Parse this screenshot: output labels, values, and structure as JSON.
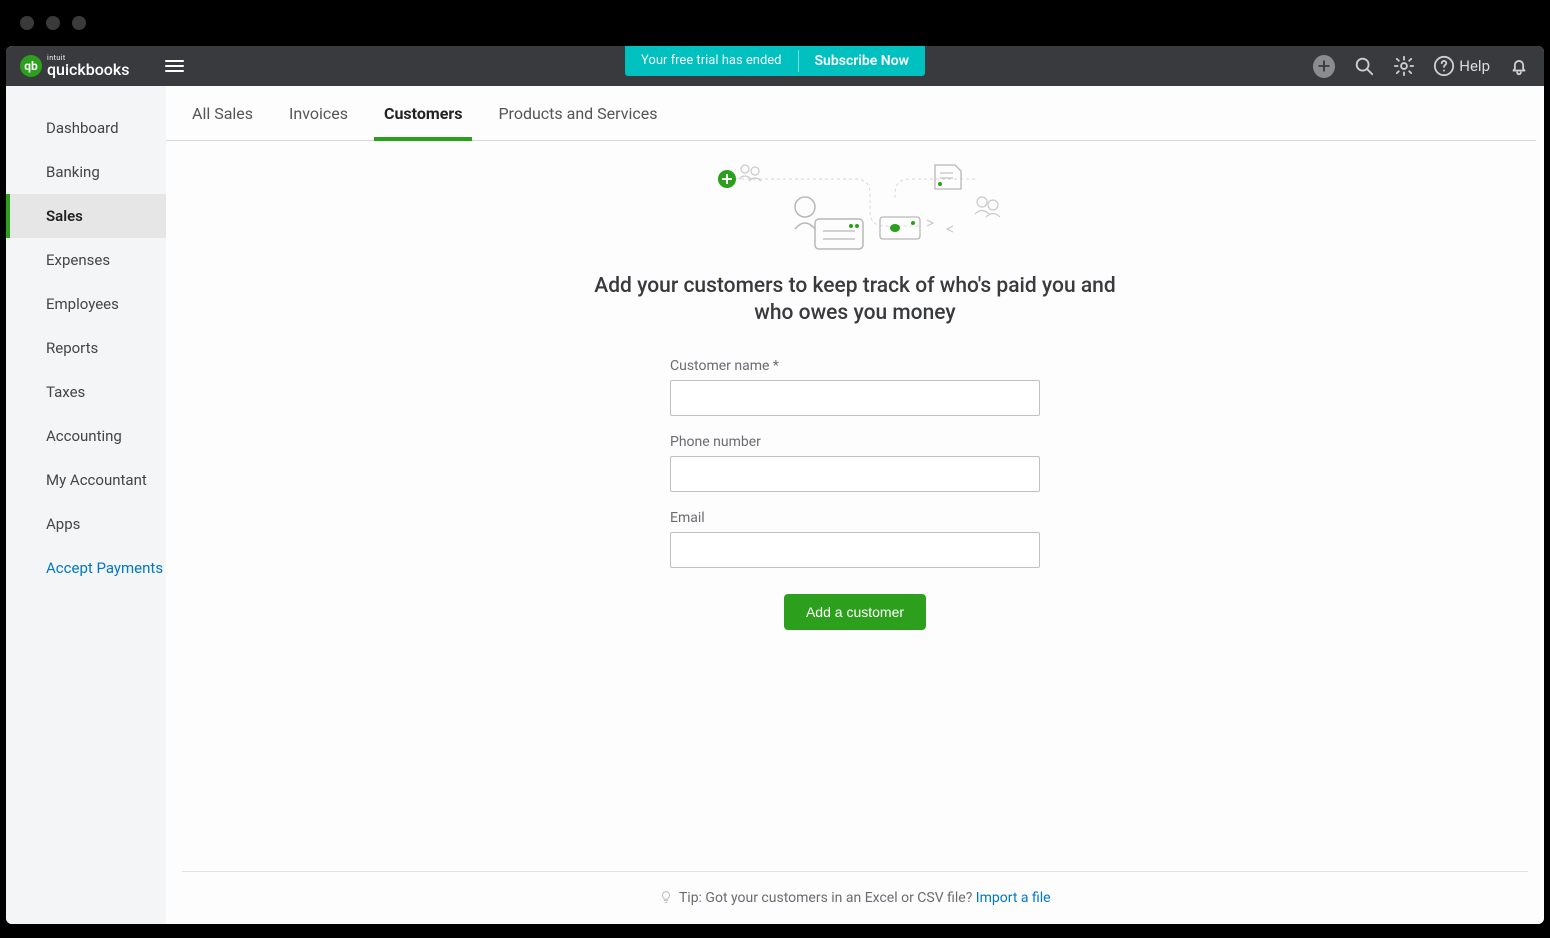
{
  "brand": {
    "intuit": "intuit",
    "name": "quickbooks",
    "mark": "qb"
  },
  "trial": {
    "ended": "Your free trial has ended",
    "subscribe": "Subscribe Now"
  },
  "header": {
    "help": "Help"
  },
  "sidebar": {
    "items": [
      {
        "label": "Dashboard"
      },
      {
        "label": "Banking"
      },
      {
        "label": "Sales"
      },
      {
        "label": "Expenses"
      },
      {
        "label": "Employees"
      },
      {
        "label": "Reports"
      },
      {
        "label": "Taxes"
      },
      {
        "label": "Accounting"
      },
      {
        "label": "My Accountant"
      },
      {
        "label": "Apps"
      },
      {
        "label": "Accept Payments"
      }
    ]
  },
  "tabs": [
    {
      "label": "All Sales"
    },
    {
      "label": "Invoices"
    },
    {
      "label": "Customers"
    },
    {
      "label": "Products and Services"
    }
  ],
  "hero": {
    "title": "Add your customers to keep track of who's paid you and who owes you money"
  },
  "form": {
    "customer_name_label": "Customer name *",
    "phone_label": "Phone number",
    "email_label": "Email",
    "customer_name_value": "",
    "phone_value": "",
    "email_value": "",
    "submit": "Add a customer"
  },
  "footer": {
    "tip_prefix": "Tip: Got your customers in an Excel or CSV file? ",
    "import_link": "Import a file"
  }
}
